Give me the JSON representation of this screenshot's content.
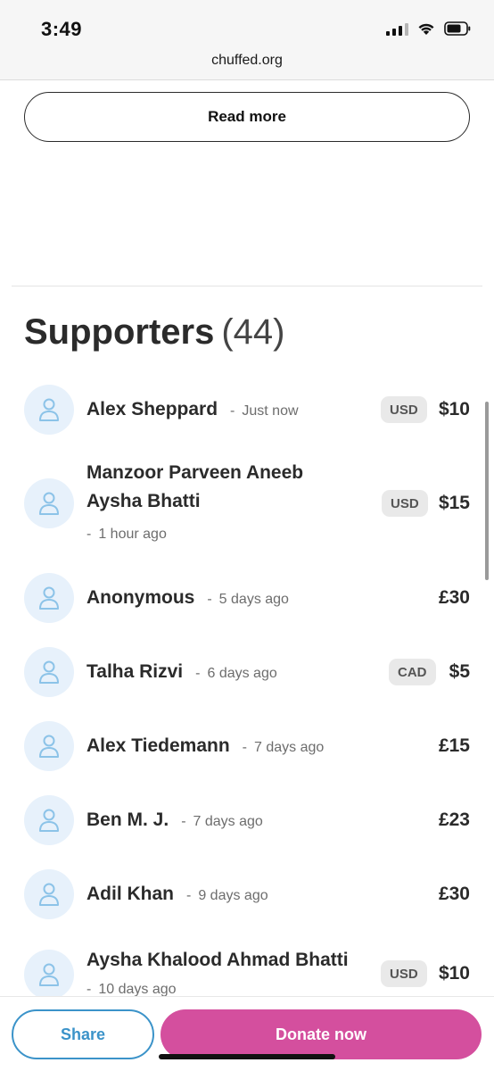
{
  "status_bar": {
    "time": "3:49"
  },
  "browser": {
    "url": "chuffed.org"
  },
  "read_more_label": "Read more",
  "supporters": {
    "heading": "Supporters",
    "count": "(44)",
    "items": [
      {
        "name": "Alex Sheppard",
        "time": "Just now",
        "currency": "USD",
        "amount": "$10"
      },
      {
        "name": "Manzoor Parveen Aneeb Aysha Bhatti",
        "time": "1 hour ago",
        "currency": "USD",
        "amount": "$15"
      },
      {
        "name": "Anonymous",
        "time": "5 days ago",
        "currency": "",
        "amount": "£30"
      },
      {
        "name": "Talha Rizvi",
        "time": "6 days ago",
        "currency": "CAD",
        "amount": "$5"
      },
      {
        "name": "Alex Tiedemann",
        "time": "7 days ago",
        "currency": "",
        "amount": "£15"
      },
      {
        "name": "Ben M. J.",
        "time": "7 days ago",
        "currency": "",
        "amount": "£23"
      },
      {
        "name": "Adil Khan",
        "time": "9 days ago",
        "currency": "",
        "amount": "£30"
      },
      {
        "name": "Aysha Khalood Ahmad Bhatti",
        "time": "10 days ago",
        "currency": "USD",
        "amount": "$10"
      }
    ]
  },
  "actions": {
    "share_label": "Share",
    "donate_label": "Donate now"
  },
  "colors": {
    "share": "#3b93c9",
    "donate": "#d44f9e",
    "avatar_bg": "#e7f1fb"
  },
  "dash": "-"
}
